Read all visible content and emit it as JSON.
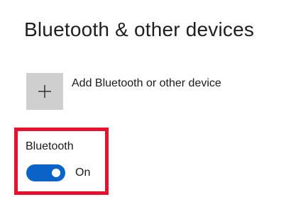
{
  "header": {
    "title": "Bluetooth & other devices"
  },
  "add_device": {
    "label": "Add Bluetooth or other device",
    "icon": "plus-icon"
  },
  "bluetooth": {
    "label": "Bluetooth",
    "toggle_state": "On",
    "is_on": true
  },
  "colors": {
    "accent": "#0a64c7",
    "highlight": "#e8112d",
    "tile": "#cfcfcf"
  }
}
